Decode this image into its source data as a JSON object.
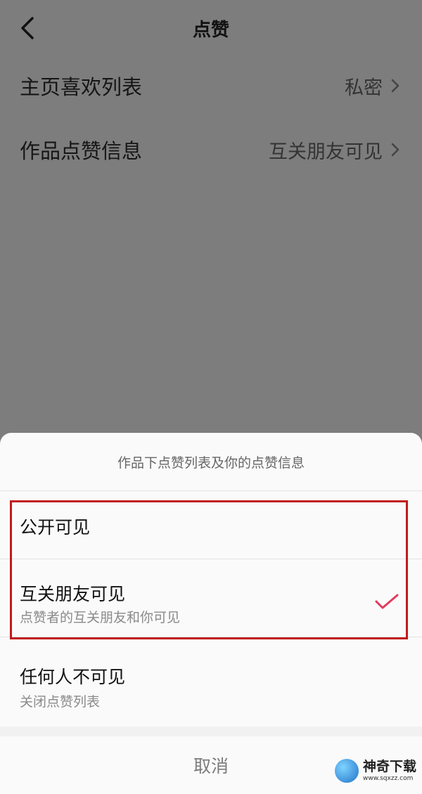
{
  "header": {
    "title": "点赞"
  },
  "settings": [
    {
      "label": "主页喜欢列表",
      "value": "私密"
    },
    {
      "label": "作品点赞信息",
      "value": "互关朋友可见"
    }
  ],
  "sheet": {
    "title": "作品下点赞列表及你的点赞信息",
    "options": [
      {
        "label": "公开可见",
        "sub": ""
      },
      {
        "label": "互关朋友可见",
        "sub": "点赞者的互关朋友和你可见",
        "selected": true
      },
      {
        "label": "任何人不可见",
        "sub": "关闭点赞列表"
      }
    ],
    "cancel": "取消"
  },
  "watermark": {
    "name": "神奇下载",
    "url": "www.sqxzz.com"
  },
  "colors": {
    "check": "#e23a5c",
    "highlight": "#c11a1a"
  }
}
